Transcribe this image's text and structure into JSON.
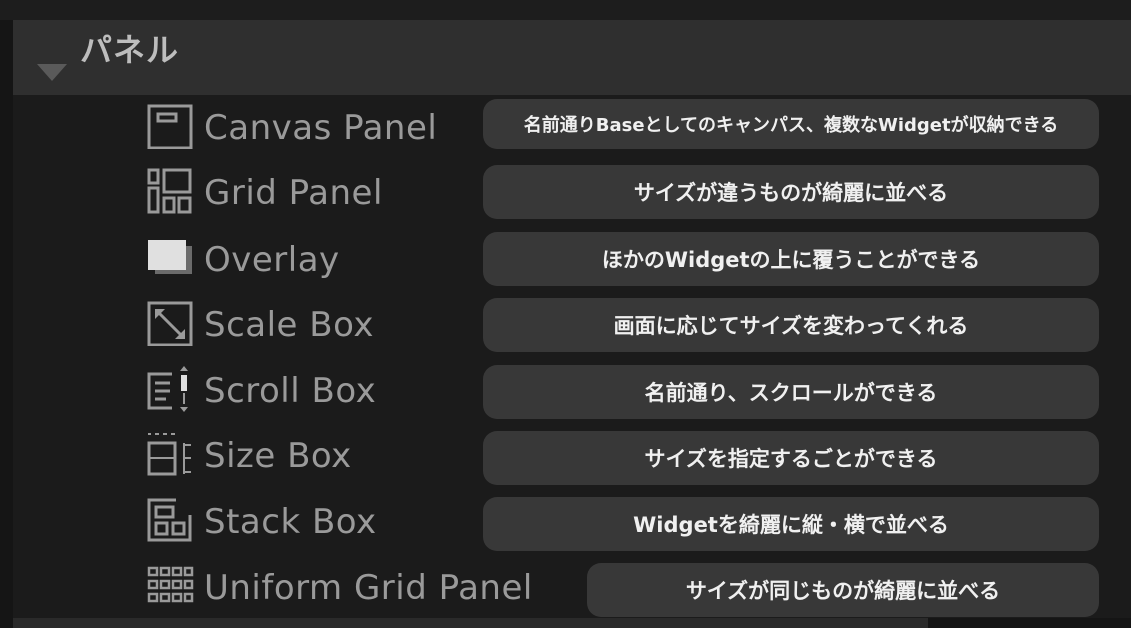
{
  "header": {
    "title": "パネル"
  },
  "items": [
    {
      "label": "Canvas Panel",
      "icon": "canvas-panel-icon",
      "description": "名前通りBaseとしてのキャンパス、複数なWidgetが収納できる"
    },
    {
      "label": "Grid Panel",
      "icon": "grid-panel-icon",
      "description": "サイズが違うものが綺麗に並べる"
    },
    {
      "label": "Overlay",
      "icon": "overlay-icon",
      "description": "ほかのWidgetの上に覆うことができる"
    },
    {
      "label": "Scale Box",
      "icon": "scale-box-icon",
      "description": "画面に応じてサイズを変わってくれる"
    },
    {
      "label": "Scroll Box",
      "icon": "scroll-box-icon",
      "description": "名前通り、スクロールができる"
    },
    {
      "label": "Size Box",
      "icon": "size-box-icon",
      "description": "サイズを指定するごとができる"
    },
    {
      "label": "Stack Box",
      "icon": "stack-box-icon",
      "description": "Widgetを綺麗に縦・横で並べる"
    },
    {
      "label": "Uniform Grid Panel",
      "icon": "uniform-grid-panel-icon",
      "description": "サイズが同じものが綺麗に並べる"
    }
  ]
}
